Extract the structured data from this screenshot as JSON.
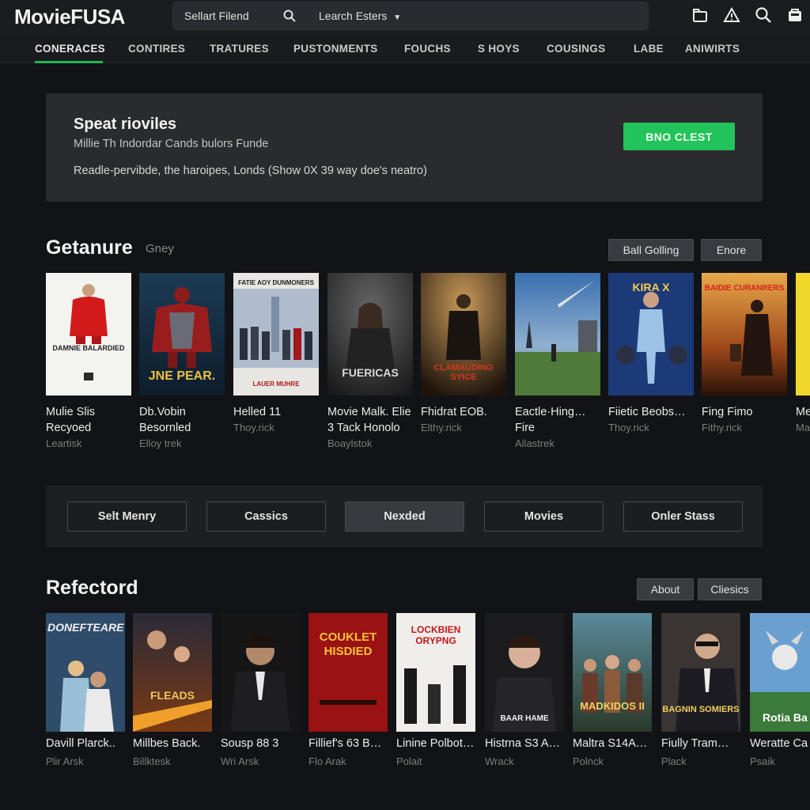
{
  "app": {
    "logo": "MovieFUSA"
  },
  "search": {
    "field_label": "Sellart Filend",
    "filter_label": "Learch Esters"
  },
  "top_icons": [
    "library-icon",
    "alert-icon",
    "search-icon",
    "bag-icon"
  ],
  "nav": {
    "items": [
      "CONERACES",
      "CONTIRES",
      "TRATURES",
      "PUSTONMENTS",
      "FOUCHS",
      "S HOYS",
      "COUSINGS",
      "LABE",
      "ANIWIRTS"
    ],
    "active_index": 0
  },
  "banner": {
    "title": "Speat rioviles",
    "subtitle": "Millie Th Indordar Cands bulors Funde",
    "body": "Readle-pervibde, the haroipes, Londs (Show 0X 39 way doe's neatro)",
    "cta": "BNO CLEST"
  },
  "section1": {
    "title": "Getanure",
    "subtitle": "Gney",
    "buttons": [
      "Ball Golling",
      "Enore"
    ],
    "cards": [
      {
        "title": "Mulie Slis Recyoed",
        "sub": "Leartisk",
        "poster_text": "DAMNIE BALARDIED",
        "poster_text2": ""
      },
      {
        "title": "Db.Vobin Besornled",
        "sub": "Elloy trek",
        "poster_text": "JNE PEAR.",
        "poster_text2": ""
      },
      {
        "title": "Helled 11",
        "sub": "Thoy.rick",
        "poster_text": "FATIE AOY DUNMONERS",
        "poster_text2": "LAUER MUHRE"
      },
      {
        "title": "Movie Malk. Elie 3 Tack Honolo",
        "sub": "Boaylstok",
        "poster_text": "FUERICAS",
        "poster_text2": ""
      },
      {
        "title": "Fhidrat EOB.",
        "sub": "Elthy.rick",
        "poster_text": "CLAMAUDING SYICE",
        "poster_text2": ""
      },
      {
        "title": "Eactle·Hing… Fire",
        "sub": "Allastrek",
        "poster_text": "",
        "poster_text2": ""
      },
      {
        "title": "Fiietic Beobs…",
        "sub": "Thoy.rick",
        "poster_text": "KIRA X",
        "poster_text2": ""
      },
      {
        "title": "Fing Fimo",
        "sub": "Fithy.rick",
        "poster_text": "BAIDIE CURANRERS",
        "poster_text2": ""
      },
      {
        "title": "Me",
        "sub": "Ma",
        "poster_text": "",
        "poster_text2": ""
      }
    ]
  },
  "filters": {
    "items": [
      "Selt Menry",
      "Cassics",
      "Nexded",
      "Movies",
      "Onler Stass"
    ],
    "active_index": 2
  },
  "section2": {
    "title": "Refectord",
    "buttons": [
      "About",
      "Cliesics"
    ],
    "cards": [
      {
        "title": "Davill Plarck..",
        "sub": "Plir Arsk",
        "poster_text": "DONEFTEARE"
      },
      {
        "title": "Millbes Back.",
        "sub": "Billktesk",
        "poster_text": "FLEADS"
      },
      {
        "title": "Sousp 88 3",
        "sub": "Wri Arsk",
        "poster_text": ""
      },
      {
        "title": "Fillief's 63 B…",
        "sub": "Flo Arak",
        "poster_text": "COUKLET HISDIED"
      },
      {
        "title": "Linine Polbot…",
        "sub": "Polait",
        "poster_text": "LOCKBIEN ORYPNG"
      },
      {
        "title": "Histrna S3 A…",
        "sub": "Wrack",
        "poster_text": "BAAR HAME"
      },
      {
        "title": "Maltra S14A…",
        "sub": "Polnck",
        "poster_text": "MADKIDOS II"
      },
      {
        "title": "Fiully Tram…",
        "sub": "Plack",
        "poster_text": "BAGNIN SOMIERS"
      },
      {
        "title": "Weratte Ca",
        "sub": "Psaik",
        "poster_text": "Rotia Ba"
      }
    ]
  },
  "colors": {
    "accent": "#22c35a",
    "background": "#121316",
    "surface": "#2a2b2f"
  }
}
